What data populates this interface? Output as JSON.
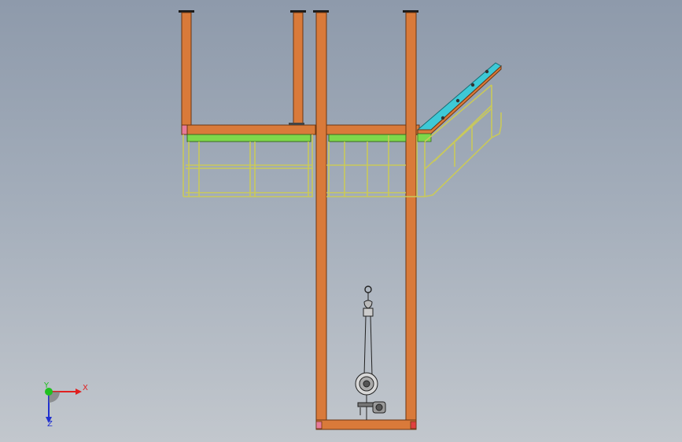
{
  "viewport": {
    "colors": {
      "steel_beam": "#d97a3a",
      "steel_edge": "#6b3512",
      "deck": "#7ed84a",
      "railing": "#c9c95a",
      "stair_rail": "#3ec9d6",
      "hoist": "#9a9a9a"
    }
  },
  "triad": {
    "x_label": "X",
    "y_label": "Y",
    "z_label": "Z",
    "x_color": "#e02020",
    "y_color": "#20c020",
    "z_color": "#2030d0"
  }
}
